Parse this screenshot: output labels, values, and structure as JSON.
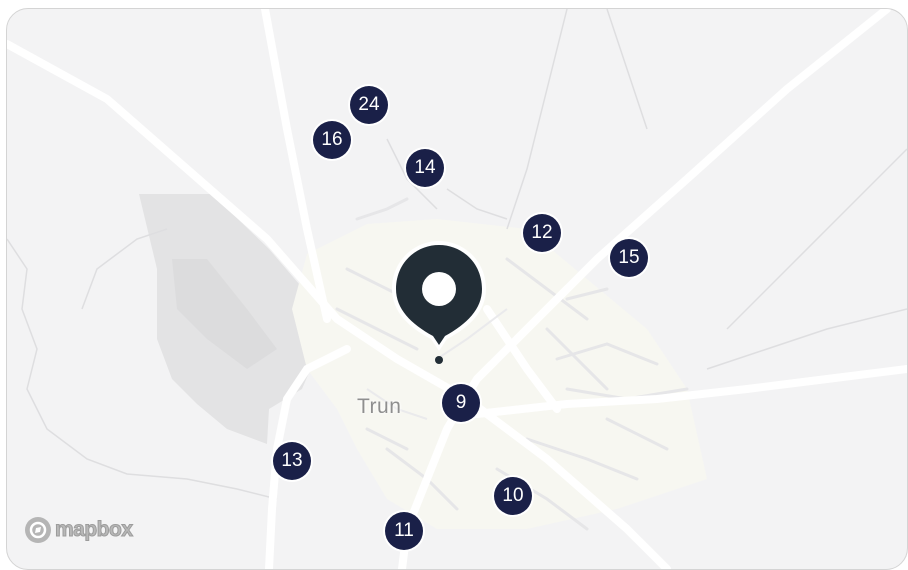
{
  "map": {
    "place_label": "Trun",
    "attribution_logo": "mapbox",
    "selected_marker": {
      "icon": "location-pin-icon",
      "color": "#222d36"
    },
    "cluster_color": "#1a2048",
    "clusters": [
      {
        "count": "24"
      },
      {
        "count": "16"
      },
      {
        "count": "14"
      },
      {
        "count": "12"
      },
      {
        "count": "15"
      },
      {
        "count": "9"
      },
      {
        "count": "13"
      },
      {
        "count": "10"
      },
      {
        "count": "11"
      }
    ]
  }
}
